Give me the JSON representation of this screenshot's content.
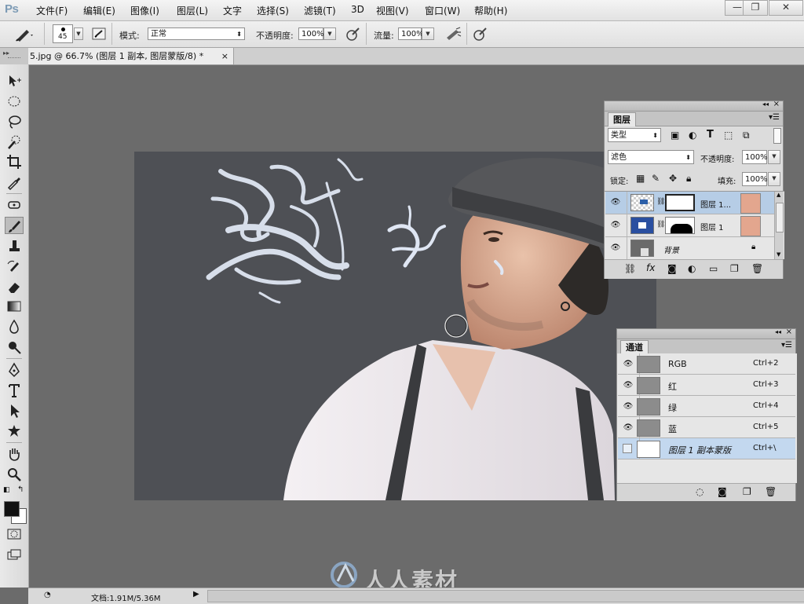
{
  "app": {
    "logo": "Ps"
  },
  "menu": [
    "文件(F)",
    "编辑(E)",
    "图像(I)",
    "图层(L)",
    "文字",
    "选择(S)",
    "滤镜(T)",
    "3D",
    "视图(V)",
    "窗口(W)",
    "帮助(H)"
  ],
  "window_controls": {
    "minimize": "—",
    "restore": "❐",
    "close": "✕"
  },
  "options": {
    "brush_size": "45",
    "mode_label": "模式:",
    "mode_value": "正常",
    "opacity_label": "不透明度:",
    "opacity_value": "100%",
    "flow_label": "流量:",
    "flow_value": "100%"
  },
  "document": {
    "tab_title": "5.jpg @ 66.7% (图层 1 副本, 图层蒙版/8) *",
    "close": "×"
  },
  "layers_panel": {
    "tab": "图层",
    "filter_kind": "类型",
    "blend_mode": "滤色",
    "opacity_label": "不透明度:",
    "opacity_value": "100%",
    "lock_label": "锁定:",
    "fill_label": "填充:",
    "fill_value": "100%",
    "layers": [
      {
        "name": "图层 1...",
        "selected": true
      },
      {
        "name": "图层 1",
        "selected": false
      },
      {
        "name": "背景",
        "selected": false
      }
    ]
  },
  "channels_panel": {
    "tab": "通道",
    "channels": [
      {
        "name": "RGB",
        "shortcut": "Ctrl+2"
      },
      {
        "name": "红",
        "shortcut": "Ctrl+3"
      },
      {
        "name": "绿",
        "shortcut": "Ctrl+4"
      },
      {
        "name": "蓝",
        "shortcut": "Ctrl+5"
      },
      {
        "name": "图层 1 副本蒙版",
        "shortcut": "Ctrl+\\"
      }
    ]
  },
  "status": {
    "doc_label": "文档:1.91M/5.36M"
  },
  "watermark": {
    "text": "人人素材"
  },
  "colors": {
    "canvas_bg": "#4e5055",
    "workspace": "#6b6b6b",
    "selected_layer": "#b6cde6"
  }
}
